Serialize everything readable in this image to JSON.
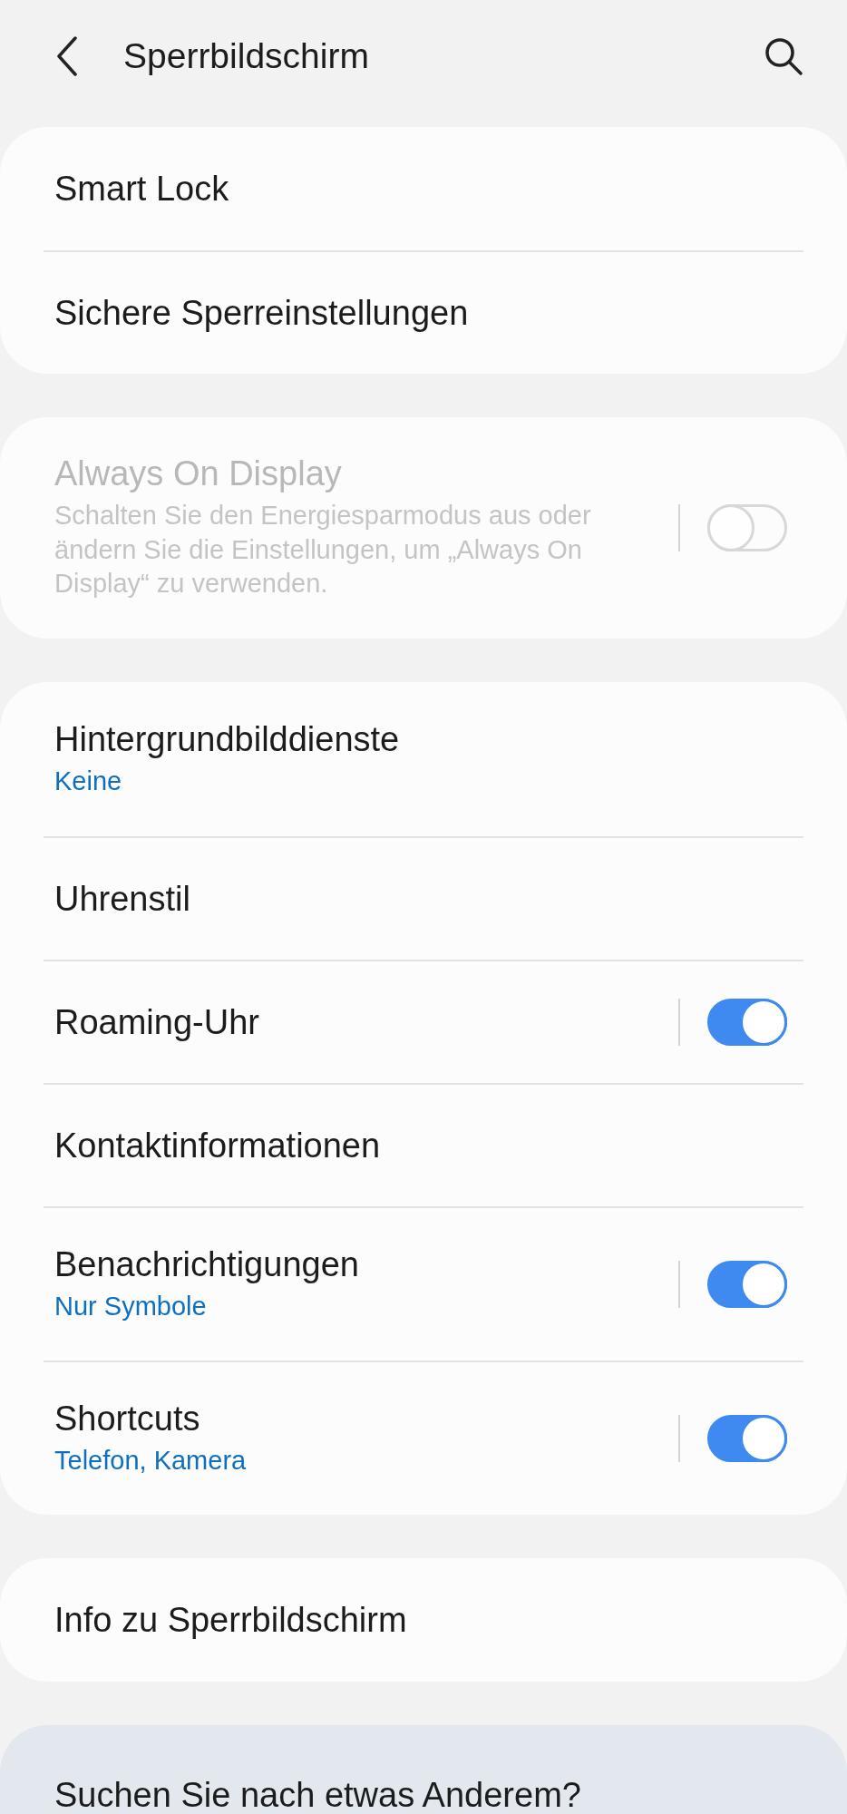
{
  "header": {
    "title": "Sperrbildschirm"
  },
  "cards": [
    {
      "items": [
        {
          "kind": "link",
          "title": "Smart Lock",
          "disabled": false
        },
        {
          "kind": "link",
          "title": "Sichere Sperreinstellungen",
          "disabled": false
        }
      ]
    },
    {
      "items": [
        {
          "kind": "switch",
          "title": "Always On Display",
          "subtitle": "Schalten Sie den Energiesparmodus aus oder ändern Sie die Einstellungen, um „Always On Display“ zu verwenden.",
          "on": false,
          "disabled": true
        }
      ]
    },
    {
      "items": [
        {
          "kind": "link",
          "title": "Hintergrundbilddienste",
          "subtitle": "Keine",
          "disabled": false
        },
        {
          "kind": "link",
          "title": "Uhrenstil",
          "disabled": false
        },
        {
          "kind": "switch",
          "title": "Roaming-Uhr",
          "on": true,
          "disabled": false
        },
        {
          "kind": "link",
          "title": "Kontaktinformationen",
          "disabled": false
        },
        {
          "kind": "switch",
          "title": "Benachrichtigungen",
          "subtitle": "Nur Symbole",
          "on": true,
          "disabled": false
        },
        {
          "kind": "switch",
          "title": "Shortcuts",
          "subtitle": "Telefon, Kamera",
          "on": true,
          "disabled": false
        }
      ]
    },
    {
      "items": [
        {
          "kind": "link",
          "title": "Info zu Sperrbildschirm",
          "disabled": false
        }
      ]
    }
  ],
  "suggestion": {
    "text": "Suchen Sie nach etwas Anderem?"
  }
}
